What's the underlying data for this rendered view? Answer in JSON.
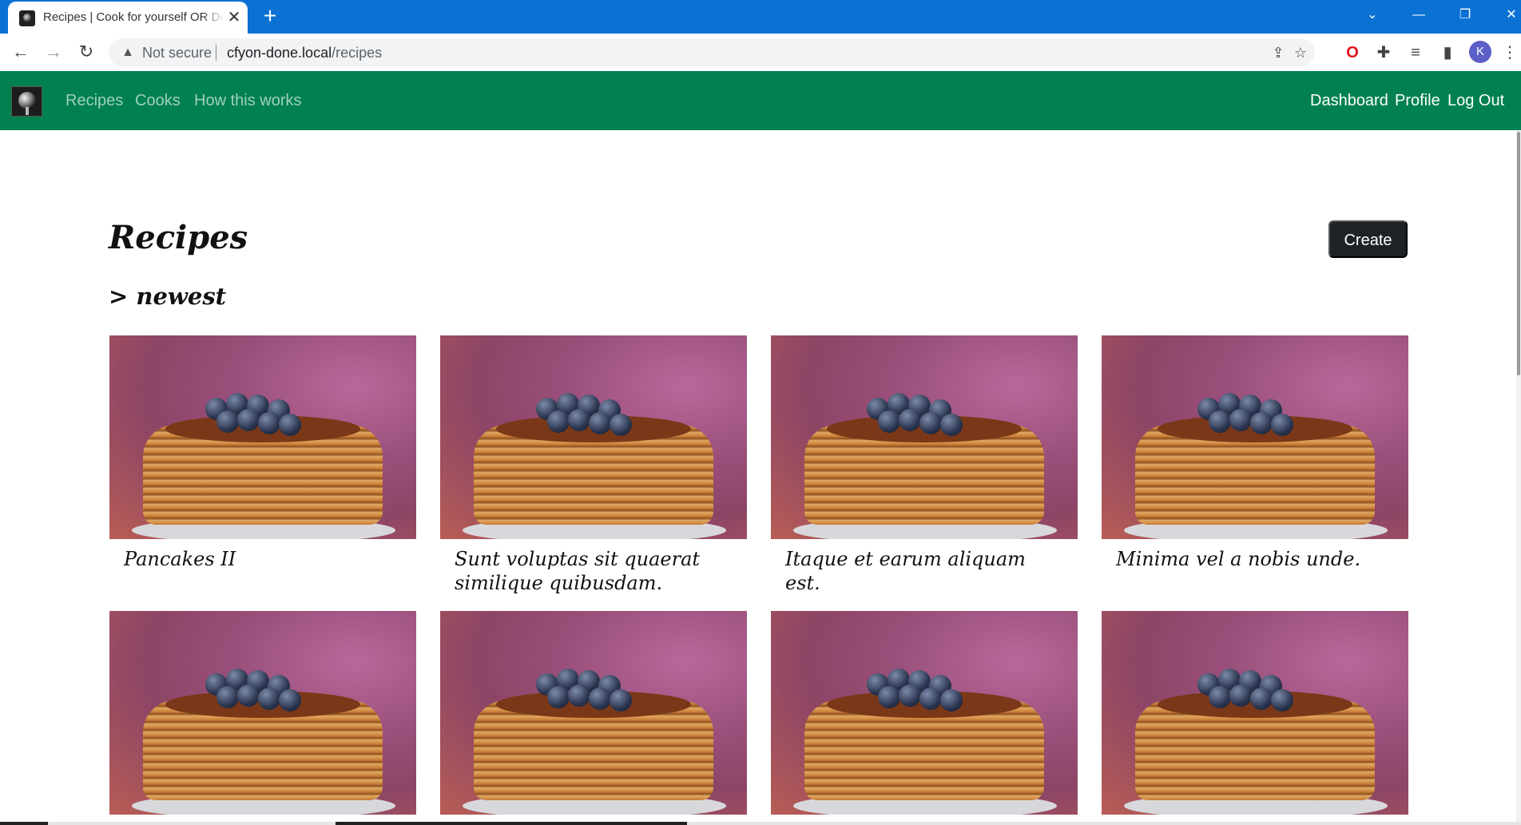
{
  "browser": {
    "tab_title": "Recipes | Cook for yourself OR Done",
    "close_glyph": "✕",
    "new_tab_glyph": "+",
    "security_label": "Not secure",
    "url_host": "cfyon-done.local",
    "url_path": "/recipes",
    "profile_initial": "K",
    "icons": [
      "back-icon",
      "forward-icon",
      "reload-icon",
      "warning-icon",
      "share-icon",
      "star-icon",
      "opera-icon",
      "extensions-icon",
      "reading-list-icon",
      "side-panel-icon",
      "menu-icon"
    ]
  },
  "nav": {
    "links": [
      "Recipes",
      "Cooks",
      "How this works"
    ],
    "right_links": [
      "Dashboard",
      "Profile",
      "Log Out"
    ],
    "link_color": "#01814f"
  },
  "page": {
    "title": "Recipes",
    "create_label": "Create",
    "subtitle": "> newest"
  },
  "recipes": [
    {
      "title": "Pancakes II"
    },
    {
      "title": "Sunt voluptas sit quaerat similique quibusdam."
    },
    {
      "title": "Itaque et earum aliquam est."
    },
    {
      "title": "Minima vel a nobis unde."
    },
    {
      "title": ""
    },
    {
      "title": ""
    },
    {
      "title": ""
    },
    {
      "title": ""
    }
  ]
}
